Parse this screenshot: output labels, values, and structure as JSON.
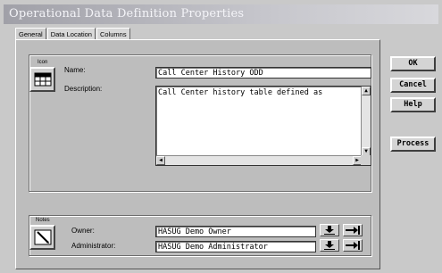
{
  "window": {
    "title": "Operational Data Definition Properties"
  },
  "tabs": [
    {
      "label": "General",
      "active": true
    },
    {
      "label": "Data Location",
      "active": false
    },
    {
      "label": "Columns",
      "active": false
    }
  ],
  "general": {
    "icon_label": "Icon",
    "name_label": "Name:",
    "name_value": "Call Center History ODD",
    "description_label": "Description:",
    "description_value": "Call Center history table defined as",
    "notes_label": "Notes",
    "owner_label": "Owner:",
    "owner_value": "HASUG Demo Owner",
    "administrator_label": "Administrator:",
    "administrator_value": "HASUG Demo Administrator"
  },
  "buttons": {
    "ok": "OK",
    "cancel": "Cancel",
    "help": "Help",
    "process": "Process"
  },
  "colors": {
    "title_bar": "#a0a0a8",
    "panel": "#bdbdbd",
    "field_bg": "#ffffff"
  }
}
